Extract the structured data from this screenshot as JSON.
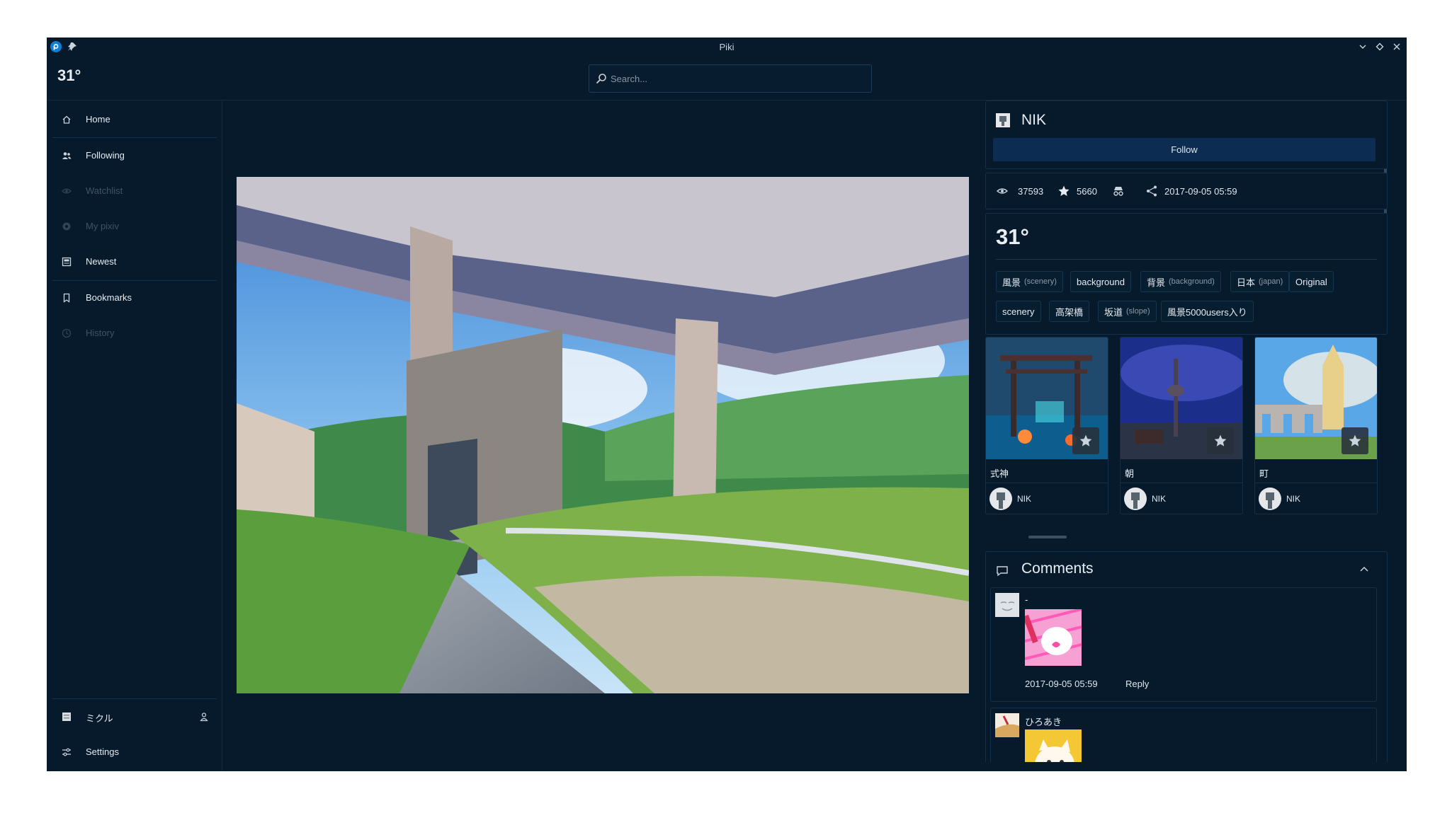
{
  "window": {
    "title": "Piki"
  },
  "header": {
    "brand": "31°",
    "search_placeholder": "Search..."
  },
  "sidebar": {
    "items": [
      {
        "label": "Home",
        "icon": "home-icon",
        "enabled": true
      },
      {
        "label": "Following",
        "icon": "users-icon",
        "enabled": true
      },
      {
        "label": "Watchlist",
        "icon": "eye-icon",
        "enabled": false
      },
      {
        "label": "My pixiv",
        "icon": "circle-icon",
        "enabled": false
      },
      {
        "label": "Newest",
        "icon": "image-icon",
        "enabled": true
      },
      {
        "label": "Bookmarks",
        "icon": "bookmark-icon",
        "enabled": true
      },
      {
        "label": "History",
        "icon": "clock-icon",
        "enabled": false
      }
    ],
    "account_label": "ミクル",
    "settings_label": "Settings"
  },
  "author": {
    "name": "NIK",
    "follow_label": "Follow"
  },
  "stats": {
    "views": "37593",
    "bookmarks": "5660",
    "date": "2017-09-05 05:59"
  },
  "artwork": {
    "title": "31°",
    "tags": [
      {
        "name": "風景",
        "translation": "(scenery)"
      },
      {
        "name": "background",
        "translation": ""
      },
      {
        "name": "背景",
        "translation": "(background)"
      },
      {
        "name": "日本",
        "translation": "(japan)"
      },
      {
        "name": "Original",
        "translation": ""
      },
      {
        "name": "scenery",
        "translation": ""
      },
      {
        "name": "高架橋",
        "translation": ""
      },
      {
        "name": "坂道",
        "translation": "(slope)"
      },
      {
        "name": "風景5000users入り",
        "translation": ""
      }
    ]
  },
  "related": [
    {
      "title": "式神",
      "author": "NIK"
    },
    {
      "title": "朝",
      "author": "NIK"
    },
    {
      "title": "町",
      "author": "NIK"
    }
  ],
  "comments": {
    "title": "Comments",
    "items": [
      {
        "author": "-",
        "date": "2017-09-05 05:59",
        "reply_label": "Reply"
      },
      {
        "author": "ひろあき",
        "date": "",
        "reply_label": ""
      }
    ]
  },
  "colors": {
    "background": "#061a2b",
    "border": "#143049",
    "follow_button": "#0c2c52",
    "accent": "#0e7fd4"
  }
}
